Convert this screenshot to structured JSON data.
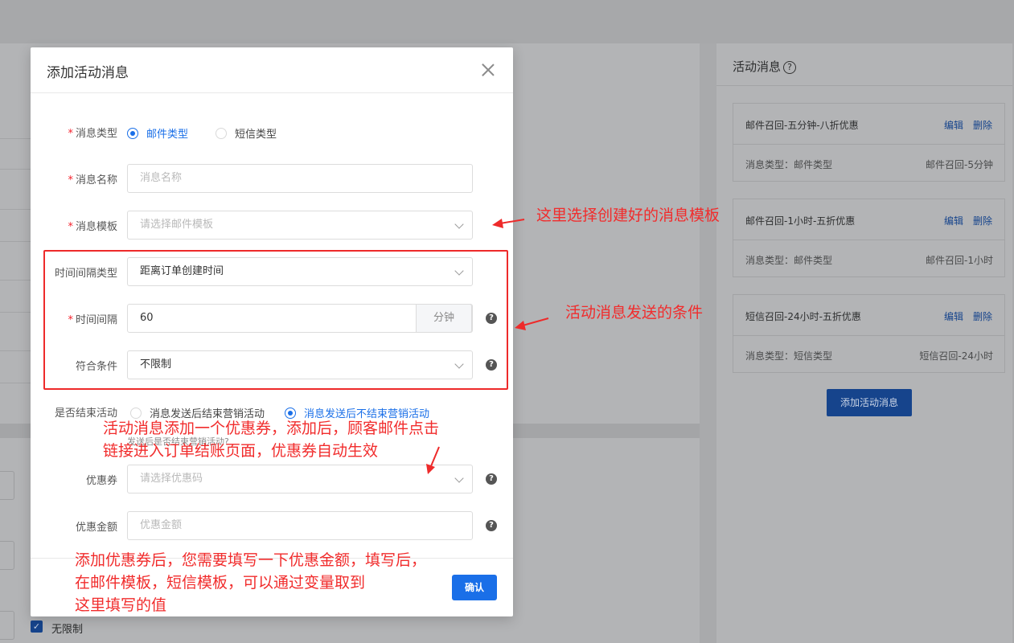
{
  "background": {
    "panel_title": "活动消息",
    "help_icon": "?",
    "cards": [
      {
        "name": "邮件召回-五分钟-八折优惠",
        "edit": "编辑",
        "delete": "删除",
        "type_label": "消息类型：邮件类型",
        "value": "邮件召回-5分钟"
      },
      {
        "name": "邮件召回-1小时-五折优惠",
        "edit": "编辑",
        "delete": "删除",
        "type_label": "消息类型：邮件类型",
        "value": "邮件召回-1小时"
      },
      {
        "name": "短信召回-24小时-五折优惠",
        "edit": "编辑",
        "delete": "删除",
        "type_label": "消息类型：短信类型",
        "value": "短信召回-24小时"
      }
    ],
    "add_button": "添加活动消息",
    "checkbox_label": "无限制",
    "checkbox_mark": "✓"
  },
  "modal": {
    "title": "添加活动消息",
    "message_type": {
      "label": "消息类型",
      "options": [
        "邮件类型",
        "短信类型"
      ],
      "selected": "邮件类型"
    },
    "message_name": {
      "label": "消息名称",
      "placeholder": "消息名称"
    },
    "message_template": {
      "label": "消息模板",
      "placeholder": "请选择邮件模板"
    },
    "interval_type": {
      "label": "时间间隔类型",
      "value": "距离订单创建时间"
    },
    "interval": {
      "label": "时间间隔",
      "value": "60",
      "unit": "分钟"
    },
    "condition": {
      "label": "符合条件",
      "value": "不限制"
    },
    "end_activity": {
      "label": "是否结束活动",
      "options": [
        "消息发送后结束营销活动",
        "消息发送后不结束营销活动"
      ],
      "selected": "消息发送后不结束营销活动",
      "hint": "发送后是否结束营销活动?"
    },
    "coupon": {
      "label": "优惠券",
      "placeholder": "请选择优惠码"
    },
    "coupon_amount": {
      "label": "优惠金额",
      "placeholder": "优惠金额"
    },
    "help_mark": "?",
    "confirm": "确认"
  },
  "annotations": {
    "template_note": "这里选择创建好的消息模板",
    "condition_note": "活动消息发送的条件",
    "coupon_note_1": "活动消息添加一个优惠券，添加后，顾客邮件点击",
    "coupon_note_2": "链接进入订单结账页面，优惠券自动生效",
    "amount_note_1": "添加优惠券后，您需要填写一下优惠金额，填写后，",
    "amount_note_2": "在邮件模板，短信模板，可以通过变量取到",
    "amount_note_3": "这里填写的值",
    "color": "#f12c2c"
  }
}
